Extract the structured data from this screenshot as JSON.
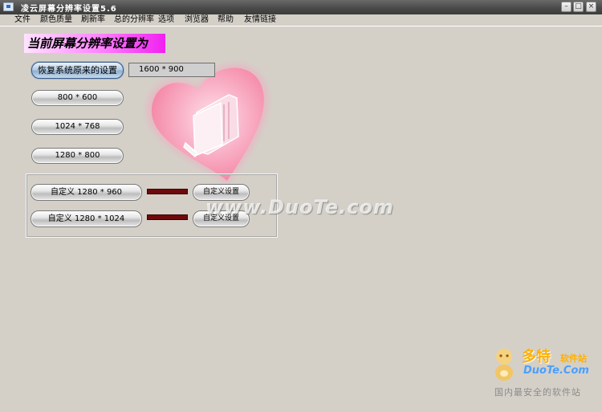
{
  "window": {
    "title": "凌云屏幕分辨率设置5.6",
    "minimize_glyph": "–",
    "maximize_glyph": "□",
    "close_glyph": "×"
  },
  "menu": {
    "items": [
      "文件",
      "颜色质量",
      "刷新率",
      "总的分辨率",
      "选项",
      "浏览器",
      "帮助",
      "友情链接"
    ]
  },
  "header": {
    "label": "当前屏幕分辨率设置为"
  },
  "current_resolution": "1600 * 900",
  "buttons": {
    "restore": "恢复系统原来的设置",
    "res_800": "800 * 600",
    "res_1024": "1024 * 768",
    "res_1280": "1280 * 800"
  },
  "custom": {
    "row1_label": "自定义 1280 * 960",
    "row2_label": "自定义 1280 * 1024",
    "set_label": "自定义设置",
    "bar_color": "#6e0a0a"
  },
  "watermarks": {
    "center": "www.DuoTe.com",
    "logo_cn": "多特",
    "logo_suffix": "软件站",
    "logo_en": "DuoTe.Com",
    "slogan": "国内最安全的软件站"
  },
  "icons": {
    "app": "app-window-icon",
    "heart": "heart-folder-icon",
    "mascot": "mascot-icon"
  },
  "colors": {
    "banner_gradient_end": "#f020f0",
    "heart_pink": "#f7a3bd",
    "logo_orange": "#ffb000",
    "logo_blue": "#4aa0ff"
  }
}
